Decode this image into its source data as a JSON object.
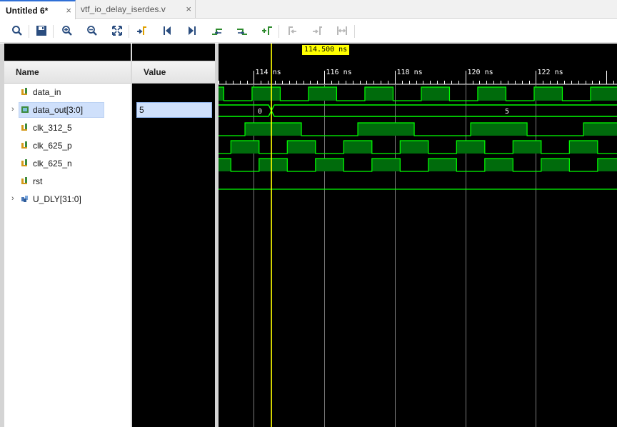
{
  "tabs": [
    {
      "label": "Untitled 6*",
      "active": true
    },
    {
      "label": "vtf_io_delay_iserdes.v",
      "active": false
    }
  ],
  "toolbar": {
    "buttons": [
      "search-icon",
      "save-icon",
      "zoom-in-icon",
      "zoom-out-icon",
      "zoom-fit-icon",
      "go-to-cursor-icon",
      "go-to-time-zero-icon",
      "go-to-last-time-icon",
      "previous-transition-icon",
      "next-transition-icon",
      "add-marker-icon",
      "previous-marker-icon",
      "next-marker-icon",
      "swap-cursors-icon"
    ]
  },
  "columns": {
    "name": "Name",
    "value": "Value"
  },
  "signals": [
    {
      "name": "data_in",
      "value": "",
      "type": "wire",
      "expandable": false,
      "selected": false
    },
    {
      "name": "data_out[3:0]",
      "value": "5",
      "type": "bus",
      "expandable": true,
      "selected": true
    },
    {
      "name": "clk_312_5",
      "value": "",
      "type": "wire",
      "expandable": false,
      "selected": false
    },
    {
      "name": "clk_625_p",
      "value": "",
      "type": "wire",
      "expandable": false,
      "selected": false
    },
    {
      "name": "clk_625_n",
      "value": "",
      "type": "wire",
      "expandable": false,
      "selected": false
    },
    {
      "name": "rst",
      "value": "",
      "type": "wire",
      "expandable": false,
      "selected": false
    },
    {
      "name": "U_DLY[31:0]",
      "value": "",
      "type": "array",
      "expandable": true,
      "selected": false
    }
  ],
  "waveform": {
    "cursor": {
      "time_ns": 114.5,
      "label": "114.500 ns"
    },
    "time_ticks": [
      "114 ns",
      "116 ns",
      "118 ns",
      "120 ns",
      "122 ns"
    ],
    "time_range_ns": [
      113.0,
      124.3
    ],
    "bus_values": {
      "before": "0",
      "after": "5"
    },
    "colors": {
      "signal": "#00ff00",
      "fill": "#006b0c",
      "cursor": "#ffff00",
      "grid": "#7a7a7a",
      "background": "#000000"
    }
  }
}
